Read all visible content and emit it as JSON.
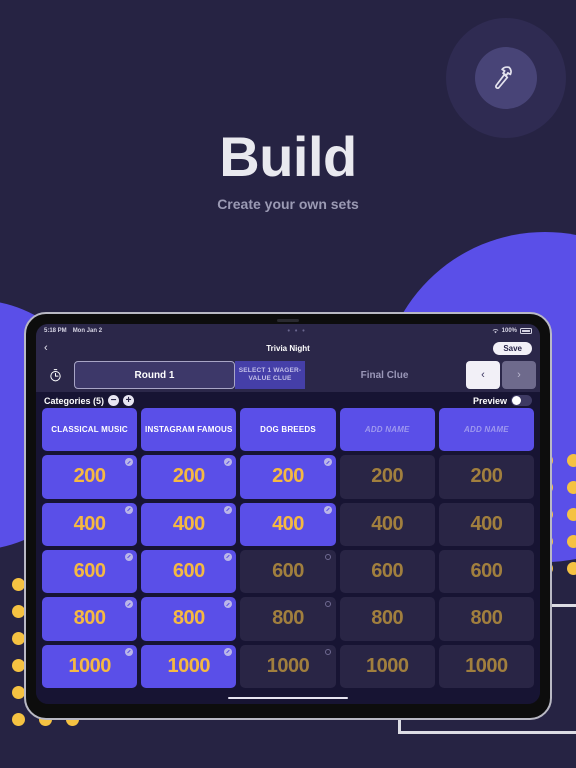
{
  "hero": {
    "title": "Build",
    "subtitle": "Create your own sets",
    "icon": "hammer-icon",
    "accent_color": "#5a4fe8",
    "bg_color": "#262343",
    "dot_color": "#f5c242"
  },
  "device": {
    "statusbar": {
      "time": "5:18 PM",
      "date": "Mon Jan 2",
      "center": "• • •",
      "wifi_icon": "wifi-icon",
      "battery_percent": "100%",
      "battery_icon": "battery-icon"
    },
    "navbar": {
      "back_icon": "chevron-left-icon",
      "title": "Trivia Night",
      "save_label": "Save"
    },
    "rounds": {
      "clock_icon": "timer-icon",
      "tabs": [
        {
          "label": "Round 1",
          "state": "active"
        },
        {
          "label": "SELECT 1 WAGER-VALUE CLUE",
          "state": "wager"
        },
        {
          "label": "Final Clue",
          "state": "final"
        }
      ],
      "prev_icon": "chevron-left-icon",
      "next_icon": "chevron-right-icon",
      "prev_label": "‹",
      "next_label": "›"
    },
    "categories_bar": {
      "label": "Categories (5)",
      "minus_label": "−",
      "plus_label": "+",
      "preview_label": "Preview",
      "preview_on": false
    },
    "board": {
      "categories": [
        {
          "name": "CLASSICAL MUSIC",
          "placeholder": false
        },
        {
          "name": "INSTAGRAM FAMOUS",
          "placeholder": false
        },
        {
          "name": "DOG BREEDS",
          "placeholder": false
        },
        {
          "name": "ADD NAME",
          "placeholder": true
        },
        {
          "name": "ADD NAME",
          "placeholder": true
        }
      ],
      "values": [
        200,
        400,
        600,
        800,
        1000
      ],
      "cells": [
        [
          {
            "value": "200",
            "filled": true,
            "badge": "done"
          },
          {
            "value": "200",
            "filled": true,
            "badge": "done"
          },
          {
            "value": "200",
            "filled": true,
            "badge": "done"
          },
          {
            "value": "200",
            "filled": false,
            "badge": "none"
          },
          {
            "value": "200",
            "filled": false,
            "badge": "none"
          }
        ],
        [
          {
            "value": "400",
            "filled": true,
            "badge": "done"
          },
          {
            "value": "400",
            "filled": true,
            "badge": "done"
          },
          {
            "value": "400",
            "filled": true,
            "badge": "done"
          },
          {
            "value": "400",
            "filled": false,
            "badge": "none"
          },
          {
            "value": "400",
            "filled": false,
            "badge": "none"
          }
        ],
        [
          {
            "value": "600",
            "filled": true,
            "badge": "done"
          },
          {
            "value": "600",
            "filled": true,
            "badge": "done"
          },
          {
            "value": "600",
            "filled": false,
            "badge": "open"
          },
          {
            "value": "600",
            "filled": false,
            "badge": "none"
          },
          {
            "value": "600",
            "filled": false,
            "badge": "none"
          }
        ],
        [
          {
            "value": "800",
            "filled": true,
            "badge": "done"
          },
          {
            "value": "800",
            "filled": true,
            "badge": "done"
          },
          {
            "value": "800",
            "filled": false,
            "badge": "open"
          },
          {
            "value": "800",
            "filled": false,
            "badge": "none"
          },
          {
            "value": "800",
            "filled": false,
            "badge": "none"
          }
        ],
        [
          {
            "value": "1000",
            "filled": true,
            "badge": "done"
          },
          {
            "value": "1000",
            "filled": true,
            "badge": "done"
          },
          {
            "value": "1000",
            "filled": false,
            "badge": "open"
          },
          {
            "value": "1000",
            "filled": false,
            "badge": "none"
          },
          {
            "value": "1000",
            "filled": false,
            "badge": "none"
          }
        ]
      ]
    }
  }
}
